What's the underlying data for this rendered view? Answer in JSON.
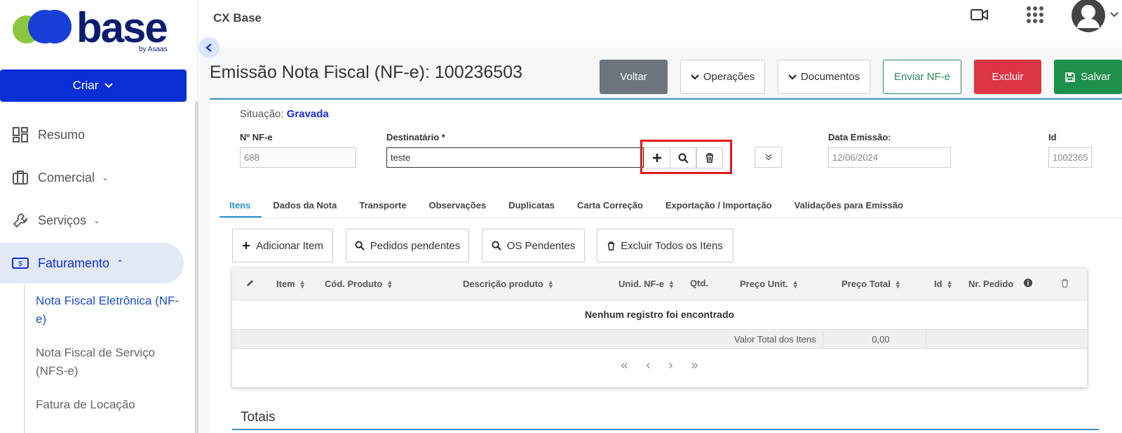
{
  "logo": {
    "word": "base",
    "sub": "by Asaas"
  },
  "sidebar": {
    "create_label": "Criar",
    "items": [
      {
        "label": "Resumo",
        "icon": "dashboard-icon"
      },
      {
        "label": "Comercial",
        "icon": "briefcase-icon"
      },
      {
        "label": "Serviços",
        "icon": "wrench-icon"
      },
      {
        "label": "Faturamento",
        "icon": "money-icon"
      }
    ],
    "subitems": [
      {
        "label": "Nota Fiscal Eletrônica (NF-e)"
      },
      {
        "label": "Nota Fiscal de Serviço (NFS-e)"
      },
      {
        "label": "Fatura de Locação"
      }
    ]
  },
  "topbar": {
    "title": "CX Base"
  },
  "page": {
    "title": "Emissão Nota Fiscal (NF-e): 100236503",
    "buttons": {
      "voltar": "Voltar",
      "operacoes": "Operações",
      "documentos": "Documentos",
      "enviar": "Enviar NF-e",
      "excluir": "Excluir",
      "salvar": "Salvar"
    }
  },
  "form": {
    "situacao_label": "Situação:",
    "situacao_value": "Gravada",
    "nfe_label": "Nº NF-e",
    "nfe_value": "688",
    "dest_label": "Destinatário *",
    "dest_value": "teste",
    "data_label": "Data Emissão:",
    "data_value": "12/06/2024",
    "id_label": "Id",
    "id_value": "1002365"
  },
  "tabs": [
    "Itens",
    "Dados da Nota",
    "Transporte",
    "Observações",
    "Duplicatas",
    "Carta Correção",
    "Exportação / Importação",
    "Validações para Emissão"
  ],
  "actions": {
    "add_item": "Adicionar Item",
    "pedidos": "Pedidos pendentes",
    "os": "OS Pendentes",
    "excluir_todos": "Excluir Todos os Itens"
  },
  "grid": {
    "columns": [
      "Item",
      "Cód. Produto",
      "Descrição produto",
      "Unid. NF-e",
      "Qtd.",
      "Preço Unit.",
      "Preço Total",
      "Id",
      "Nr. Pedido"
    ],
    "empty_text": "Nenhum registro foi encontrado",
    "total_label": "Valor Total dos Itens",
    "total_value": "0,00"
  },
  "section": {
    "totais": "Totais"
  },
  "colors": {
    "primary": "#0a2fd6",
    "danger": "#dc3545",
    "success": "#1f8f4c",
    "highlight": "#e0191f",
    "tab_active": "#2a8fd0"
  }
}
